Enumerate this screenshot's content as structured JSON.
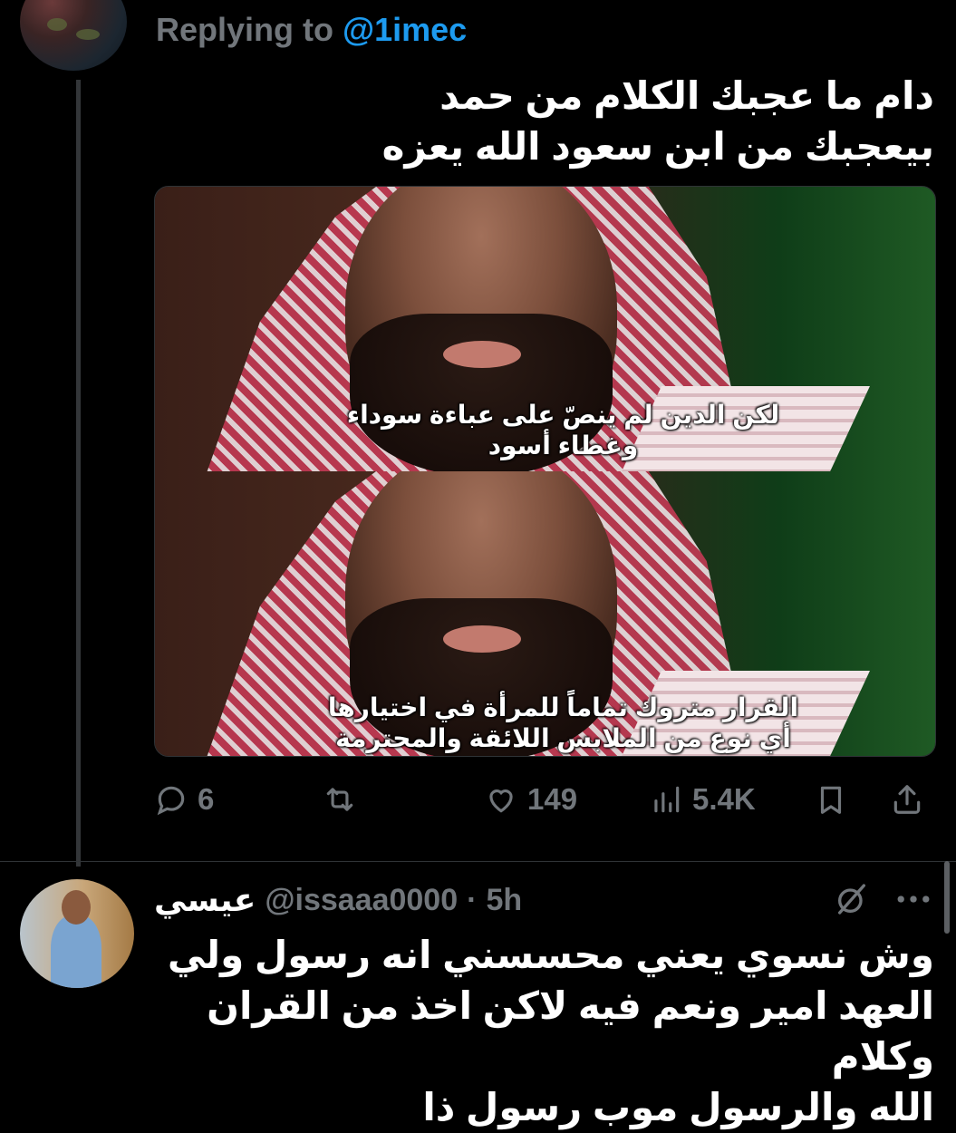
{
  "reply_context": {
    "prefix": "Replying to",
    "handle": "@1imec"
  },
  "tweet": {
    "text_lines": [
      "دام ما عجبك الكلام من حمد",
      "بيعجبك من ابن سعود الله يعزه"
    ],
    "media": {
      "frame1_caption": "لكن الدين لم ينصّ على عباءة سوداء\nوغطاء أسود",
      "frame2_caption": "القرار متروك تماماً للمرأة في اختيارها\nأي نوع من الملابس اللائقة والمحترمة"
    },
    "actions": {
      "reply_count": "6",
      "retweet_count": "",
      "like_count": "149",
      "views_count": "5.4K"
    }
  },
  "reply": {
    "display_name": "عيسي",
    "handle": "@issaaa0000",
    "separator": "·",
    "time": "5h",
    "text_lines": [
      "وش نسوي يعني محسسني انه رسول ولي",
      "العهد امير ونعم فيه لاكن اخذ من القران وكلام",
      "الله والرسول موب رسول ذا"
    ]
  },
  "icons": {
    "reply": "reply-icon",
    "retweet": "retweet-icon",
    "like": "heart-icon",
    "views": "views-icon",
    "bookmark": "bookmark-icon",
    "share": "share-icon",
    "grok": "grok-icon",
    "more": "more-icon"
  },
  "colors": {
    "background": "#000000",
    "text": "#ffffff",
    "muted": "#71767b",
    "accent": "#1d9bf0",
    "border": "#2f3336"
  }
}
